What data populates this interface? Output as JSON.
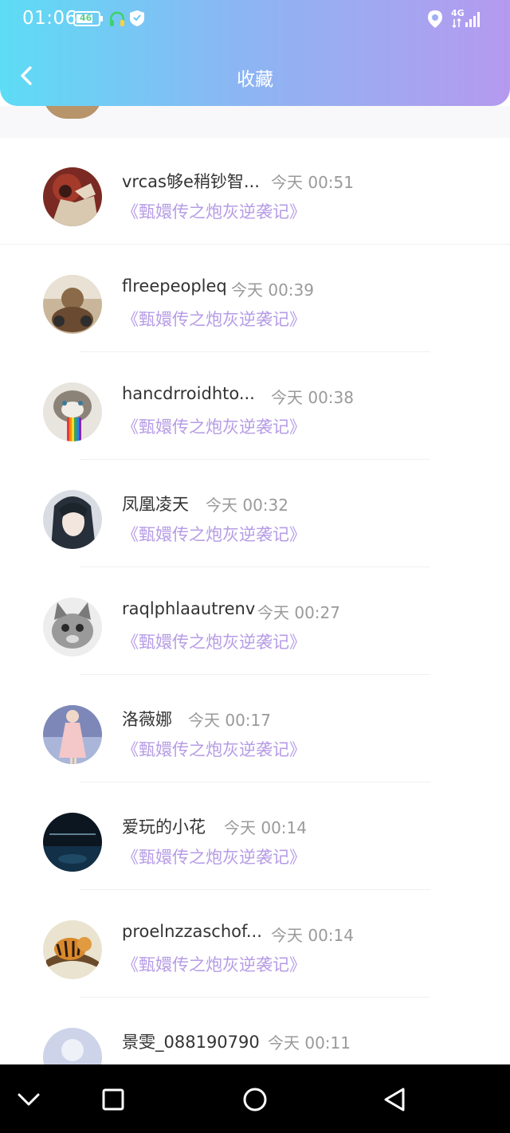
{
  "status": {
    "time": "01:06",
    "battery": "46",
    "network": "4G"
  },
  "header": {
    "title": "收藏"
  },
  "items": [
    {
      "name": "vrcas够e稍钞智...",
      "time": "今天 00:51",
      "book": "《甄嬛传之炮灰逆袭记》"
    },
    {
      "name": "flreepeopleq",
      "time": "今天 00:39",
      "book": "《甄嬛传之炮灰逆袭记》"
    },
    {
      "name": "hancdrroidhto...",
      "time": "今天 00:38",
      "book": "《甄嬛传之炮灰逆袭记》"
    },
    {
      "name": "凤凰凌天",
      "time": "今天 00:32",
      "book": "《甄嬛传之炮灰逆袭记》"
    },
    {
      "name": "raqlphlaautrenv",
      "time": "今天 00:27",
      "book": "《甄嬛传之炮灰逆袭记》"
    },
    {
      "name": "洛薇娜",
      "time": "今天 00:17",
      "book": "《甄嬛传之炮灰逆袭记》"
    },
    {
      "name": "爱玩的小花",
      "time": "今天 00:14",
      "book": "《甄嬛传之炮灰逆袭记》"
    },
    {
      "name": "proelnzzaschof...",
      "time": "今天 00:14",
      "book": "《甄嬛传之炮灰逆袭记》"
    },
    {
      "name": "景雯_088190790",
      "time": "今天 00:11",
      "book": ""
    }
  ]
}
